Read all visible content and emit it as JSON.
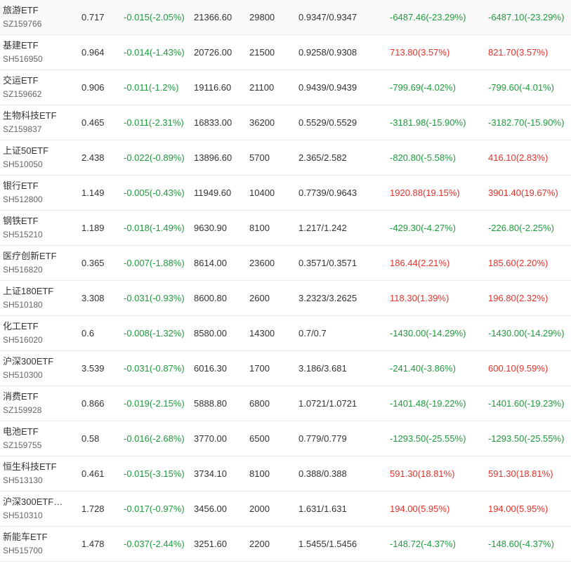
{
  "colors": {
    "up": "#e0332b",
    "down": "#1f9a3c",
    "text": "#333333",
    "subtext": "#666666",
    "divider": "#ebebeb"
  },
  "rows": [
    {
      "name": "旅游ETF",
      "code": "SZ159766",
      "price": "0.717",
      "change": "-0.015(-2.05%)",
      "amount": "21366.60",
      "volume": "29800",
      "cost": "0.9347/0.9347",
      "pl1": "-6487.46(-23.29%)",
      "pl1_dir": "down",
      "pl2": "-6487.10(-23.29%)",
      "pl2_dir": "down"
    },
    {
      "name": "基建ETF",
      "code": "SH516950",
      "price": "0.964",
      "change": "-0.014(-1.43%)",
      "amount": "20726.00",
      "volume": "21500",
      "cost": "0.9258/0.9308",
      "pl1": "713.80(3.57%)",
      "pl1_dir": "up",
      "pl2": "821.70(3.57%)",
      "pl2_dir": "up"
    },
    {
      "name": "交运ETF",
      "code": "SZ159662",
      "price": "0.906",
      "change": "-0.011(-1.2%)",
      "amount": "19116.60",
      "volume": "21100",
      "cost": "0.9439/0.9439",
      "pl1": "-799.69(-4.02%)",
      "pl1_dir": "down",
      "pl2": "-799.60(-4.01%)",
      "pl2_dir": "down"
    },
    {
      "name": "生物科技ETF",
      "code": "SZ159837",
      "price": "0.465",
      "change": "-0.011(-2.31%)",
      "amount": "16833.00",
      "volume": "36200",
      "cost": "0.5529/0.5529",
      "pl1": "-3181.98(-15.90%)",
      "pl1_dir": "down",
      "pl2": "-3182.70(-15.90%)",
      "pl2_dir": "down"
    },
    {
      "name": "上证50ETF",
      "code": "SH510050",
      "price": "2.438",
      "change": "-0.022(-0.89%)",
      "amount": "13896.60",
      "volume": "5700",
      "cost": "2.365/2.582",
      "pl1": "-820.80(-5.58%)",
      "pl1_dir": "down",
      "pl2": "416.10(2.83%)",
      "pl2_dir": "up"
    },
    {
      "name": "银行ETF",
      "code": "SH512800",
      "price": "1.149",
      "change": "-0.005(-0.43%)",
      "amount": "11949.60",
      "volume": "10400",
      "cost": "0.7739/0.9643",
      "pl1": "1920.88(19.15%)",
      "pl1_dir": "up",
      "pl2": "3901.40(19.67%)",
      "pl2_dir": "up"
    },
    {
      "name": "钢铁ETF",
      "code": "SH515210",
      "price": "1.189",
      "change": "-0.018(-1.49%)",
      "amount": "9630.90",
      "volume": "8100",
      "cost": "1.217/1.242",
      "pl1": "-429.30(-4.27%)",
      "pl1_dir": "down",
      "pl2": "-226.80(-2.25%)",
      "pl2_dir": "down"
    },
    {
      "name": "医疗创新ETF",
      "code": "SH516820",
      "price": "0.365",
      "change": "-0.007(-1.88%)",
      "amount": "8614.00",
      "volume": "23600",
      "cost": "0.3571/0.3571",
      "pl1": "186.44(2.21%)",
      "pl1_dir": "up",
      "pl2": "185.60(2.20%)",
      "pl2_dir": "up"
    },
    {
      "name": "上证180ETF",
      "code": "SH510180",
      "price": "3.308",
      "change": "-0.031(-0.93%)",
      "amount": "8600.80",
      "volume": "2600",
      "cost": "3.2323/3.2625",
      "pl1": "118.30(1.39%)",
      "pl1_dir": "up",
      "pl2": "196.80(2.32%)",
      "pl2_dir": "up"
    },
    {
      "name": "化工ETF",
      "code": "SH516020",
      "price": "0.6",
      "change": "-0.008(-1.32%)",
      "amount": "8580.00",
      "volume": "14300",
      "cost": "0.7/0.7",
      "pl1": "-1430.00(-14.29%)",
      "pl1_dir": "down",
      "pl2": "-1430.00(-14.29%)",
      "pl2_dir": "down"
    },
    {
      "name": "沪深300ETF",
      "code": "SH510300",
      "price": "3.539",
      "change": "-0.031(-0.87%)",
      "amount": "6016.30",
      "volume": "1700",
      "cost": "3.186/3.681",
      "pl1": "-241.40(-3.86%)",
      "pl1_dir": "down",
      "pl2": "600.10(9.59%)",
      "pl2_dir": "up"
    },
    {
      "name": "消费ETF",
      "code": "SZ159928",
      "price": "0.866",
      "change": "-0.019(-2.15%)",
      "amount": "5888.80",
      "volume": "6800",
      "cost": "1.0721/1.0721",
      "pl1": "-1401.48(-19.22%)",
      "pl1_dir": "down",
      "pl2": "-1401.60(-19.23%)",
      "pl2_dir": "down"
    },
    {
      "name": "电池ETF",
      "code": "SZ159755",
      "price": "0.58",
      "change": "-0.016(-2.68%)",
      "amount": "3770.00",
      "volume": "6500",
      "cost": "0.779/0.779",
      "pl1": "-1293.50(-25.55%)",
      "pl1_dir": "down",
      "pl2": "-1293.50(-25.55%)",
      "pl2_dir": "down"
    },
    {
      "name": "恒生科技ETF",
      "code": "SH513130",
      "price": "0.461",
      "change": "-0.015(-3.15%)",
      "amount": "3734.10",
      "volume": "8100",
      "cost": "0.388/0.388",
      "pl1": "591.30(18.81%)",
      "pl1_dir": "up",
      "pl2": "591.30(18.81%)",
      "pl2_dir": "up"
    },
    {
      "name": "沪深300ETF…",
      "code": "SH510310",
      "price": "1.728",
      "change": "-0.017(-0.97%)",
      "amount": "3456.00",
      "volume": "2000",
      "cost": "1.631/1.631",
      "pl1": "194.00(5.95%)",
      "pl1_dir": "up",
      "pl2": "194.00(5.95%)",
      "pl2_dir": "up"
    },
    {
      "name": "新能车ETF",
      "code": "SH515700",
      "price": "1.478",
      "change": "-0.037(-2.44%)",
      "amount": "3251.60",
      "volume": "2200",
      "cost": "1.5455/1.5456",
      "pl1": "-148.72(-4.37%)",
      "pl1_dir": "down",
      "pl2": "-148.60(-4.37%)",
      "pl2_dir": "down"
    }
  ]
}
